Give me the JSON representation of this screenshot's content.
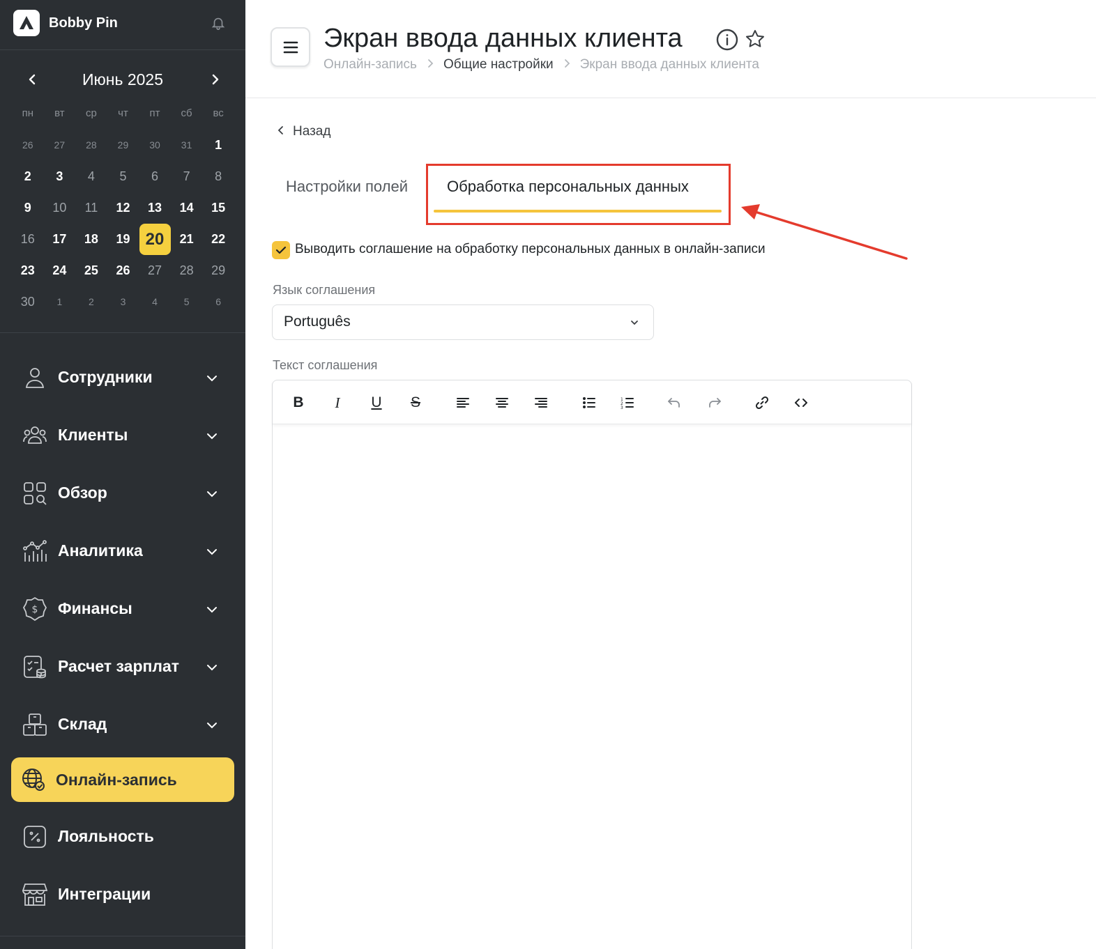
{
  "brand": {
    "name": "Bobby Pin"
  },
  "calendar": {
    "month": "Июнь 2025",
    "weekdays": [
      "пн",
      "вт",
      "ср",
      "чт",
      "пт",
      "сб",
      "вс"
    ],
    "weeks": [
      [
        "26",
        "27",
        "28",
        "29",
        "30",
        "31",
        "1"
      ],
      [
        "2",
        "3",
        "4",
        "5",
        "6",
        "7",
        "8"
      ],
      [
        "9",
        "10",
        "11",
        "12",
        "13",
        "14",
        "15"
      ],
      [
        "16",
        "17",
        "18",
        "19",
        "20",
        "21",
        "22"
      ],
      [
        "23",
        "24",
        "25",
        "26",
        "27",
        "28",
        "29"
      ],
      [
        "30",
        "1",
        "2",
        "3",
        "4",
        "5",
        "6"
      ]
    ],
    "selected": "20"
  },
  "nav": {
    "items": [
      {
        "label": "Сотрудники"
      },
      {
        "label": "Клиенты"
      },
      {
        "label": "Обзор"
      },
      {
        "label": "Аналитика"
      },
      {
        "label": "Финансы"
      },
      {
        "label": "Расчет зарплат"
      },
      {
        "label": "Склад"
      },
      {
        "label": "Онлайн-запись"
      },
      {
        "label": "Лояльность"
      },
      {
        "label": "Интеграции"
      }
    ]
  },
  "header": {
    "title": "Экран ввода данных клиента",
    "breadcrumbs": [
      "Онлайн-запись",
      "Общие настройки",
      "Экран ввода данных клиента"
    ]
  },
  "content": {
    "back_label": "Назад",
    "tabs": [
      {
        "label": "Настройки полей"
      },
      {
        "label": "Обработка персональных данных"
      }
    ],
    "checkbox_label": "Выводить соглашение на обработку персональных данных в онлайн-записи",
    "language_label": "Язык соглашения",
    "language_value": "Português",
    "text_label": "Текст соглашения"
  },
  "colors": {
    "sidebar_bg": "#2b2f33",
    "accent_yellow": "#f5c43c",
    "active_nav": "#f7d459",
    "annotation_red": "#e43b2d"
  },
  "icons": {
    "toolbar": [
      "bold-icon",
      "italic-icon",
      "underline-icon",
      "strikethrough-icon",
      "align-left-icon",
      "align-center-icon",
      "align-right-icon",
      "bullet-list-icon",
      "numbered-list-icon",
      "undo-icon",
      "redo-icon",
      "link-icon",
      "code-icon"
    ]
  }
}
